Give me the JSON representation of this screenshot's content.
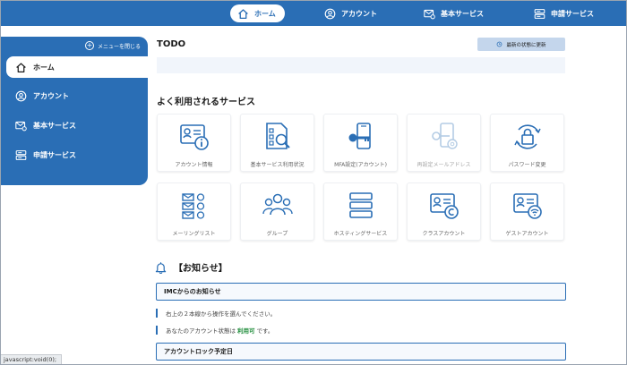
{
  "topnav": {
    "home": "ホーム",
    "account": "アカウント",
    "basic_services": "基本サービス",
    "application_services": "申請サービス"
  },
  "sidebar": {
    "close_menu": "メニューを閉じる",
    "items": [
      {
        "label": "ホーム",
        "icon": "home-icon",
        "active": true
      },
      {
        "label": "アカウント",
        "icon": "user-icon",
        "active": false
      },
      {
        "label": "基本サービス",
        "icon": "mail-gear-icon",
        "active": false
      },
      {
        "label": "申請サービス",
        "icon": "server-icon",
        "active": false
      }
    ]
  },
  "todo": {
    "title": "TODO",
    "refresh_label": "最新の状態に更新"
  },
  "services": {
    "title": "よく利用されるサービス",
    "tiles": [
      {
        "label": "アカウント情報",
        "icon": "account-info-icon",
        "enabled": true
      },
      {
        "label": "基本サービス利用状況",
        "icon": "service-usage-icon",
        "enabled": true
      },
      {
        "label": "MFA設定(アカウント)",
        "icon": "mfa-phone-key-icon",
        "enabled": true
      },
      {
        "label": "再設定メールアドレス",
        "icon": "reset-mail-key-icon",
        "enabled": false
      },
      {
        "label": "パスワード変更",
        "icon": "password-lock-icon",
        "enabled": true
      },
      {
        "label": "メーリングリスト",
        "icon": "mailing-list-icon",
        "enabled": true
      },
      {
        "label": "グループ",
        "icon": "group-icon",
        "enabled": true
      },
      {
        "label": "ホスティングサービス",
        "icon": "hosting-server-icon",
        "enabled": true
      },
      {
        "label": "クラスアカウント",
        "icon": "class-account-icon",
        "enabled": true
      },
      {
        "label": "ゲストアカウント",
        "icon": "guest-account-icon",
        "enabled": true
      }
    ]
  },
  "notices": {
    "title": "【お知らせ】",
    "imc_title": "IMCからのお知らせ",
    "line1": "右上の２本線から操作を選んでください。",
    "line2_prefix": "あなたのアカウント状態は",
    "line2_status": "利用可",
    "line2_suffix": "です。",
    "lock_title": "アカウントロック予定日"
  },
  "status_bar": "javascript:void(0);",
  "colors": {
    "primary": "#2a6eb5",
    "light_button": "#c4d6ec",
    "status_ok": "#1e8c3a"
  }
}
